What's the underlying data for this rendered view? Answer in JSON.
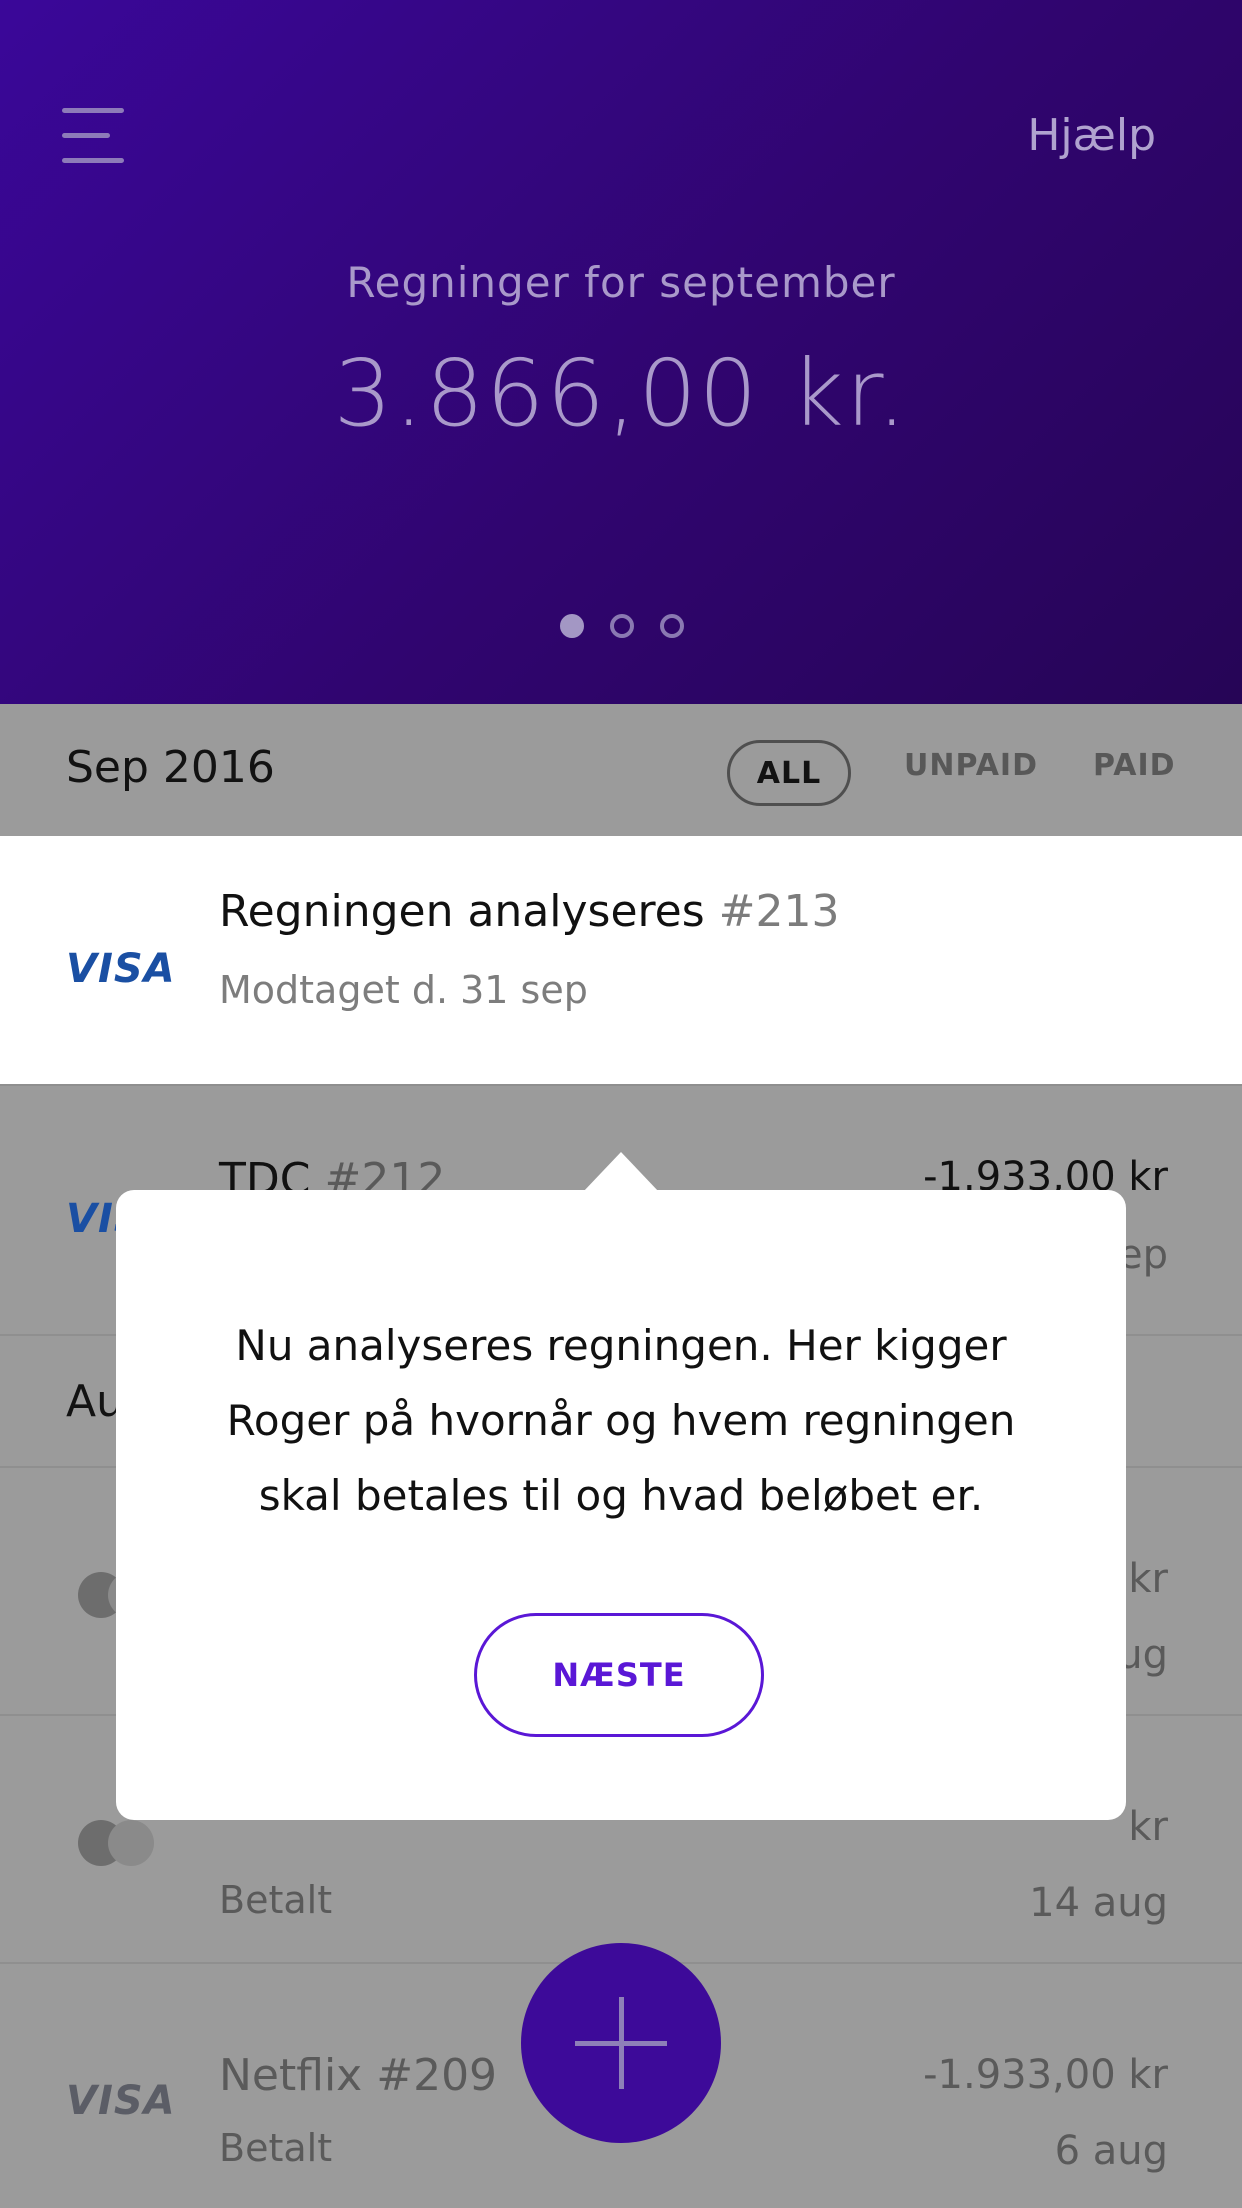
{
  "header": {
    "help_label": "Hjælp",
    "subtitle": "Regninger for september",
    "amount": "3.866,00 kr.",
    "pager": {
      "count": 3,
      "active_index": 0
    }
  },
  "filter_bar": {
    "month": "Sep 2016",
    "filters": [
      "ALL",
      "UNPAID",
      "PAID"
    ],
    "selected": "ALL"
  },
  "rows": [
    {
      "card": "VISA",
      "title": "Regningen analyseres",
      "number": "#213",
      "subtitle": "Modtaget d. 31 sep",
      "amount": "",
      "date": ""
    },
    {
      "card": "VISA",
      "title": "TDC",
      "number": "#212",
      "subtitle": "",
      "amount": "-1.933,00 kr",
      "date": "ep"
    }
  ],
  "section": {
    "label": "Au"
  },
  "aug_rows": [
    {
      "card": "mastercard",
      "title": "",
      "subtitle": "",
      "amount": "kr",
      "date": "ug"
    },
    {
      "card": "mastercard",
      "title": "",
      "subtitle": "Betalt",
      "amount": "kr",
      "date": "14 aug"
    },
    {
      "card": "VISA",
      "title": "Netflix #209",
      "subtitle": "Betalt",
      "amount": "-1.933,00 kr",
      "date": "6 aug"
    }
  ],
  "popover": {
    "lines": [
      "Nu analyseres regningen. Her kigger",
      "Roger på hvornår og hvem regningen",
      "skal betales til og hvad beløbet er."
    ],
    "next_label": "NÆSTE"
  },
  "colors": {
    "header_start": "#3a0799",
    "header_end": "#260556",
    "accent": "#5a17d6",
    "fab": "#3d0a99",
    "visa_blue": "#1a4fa3",
    "dim_overlay": "#9b9b9b"
  },
  "icons": [
    "hamburger-menu-icon",
    "visa-logo",
    "mastercard-icon",
    "plus-icon"
  ]
}
